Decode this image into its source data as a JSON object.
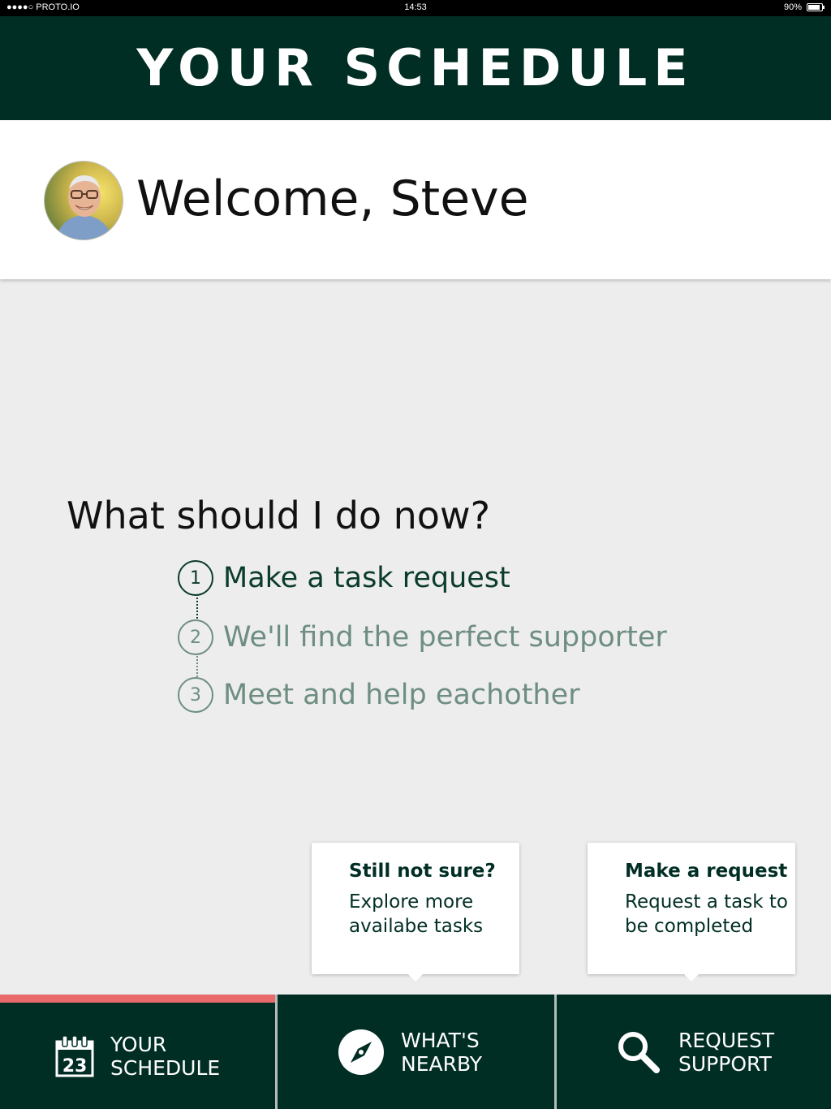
{
  "status_bar": {
    "carrier": "●●●●○ PROTO.IO",
    "time": "14:53",
    "battery": "90%"
  },
  "header": {
    "title": "YOUR SCHEDULE"
  },
  "welcome": {
    "greeting": "Welcome, Steve"
  },
  "guide": {
    "question": "What should I do now?",
    "steps": [
      {
        "number": "1",
        "label": "Make a task request"
      },
      {
        "number": "2",
        "label": "We'll find the perfect supporter"
      },
      {
        "number": "3",
        "label": "Meet and help eachother"
      }
    ]
  },
  "tips": [
    {
      "title": "Still not sure?",
      "body": "Explore more availabe tasks"
    },
    {
      "title": "Make a request",
      "body": "Request a task to be completed"
    }
  ],
  "tabs": [
    {
      "label": "YOUR\nSCHEDULE",
      "icon": "calendar-icon",
      "calendar_day": "23",
      "active": true
    },
    {
      "label": "WHAT'S\nNEARBY",
      "icon": "compass-icon",
      "active": false
    },
    {
      "label": "REQUEST\nSUPPORT",
      "icon": "search-icon",
      "active": false
    }
  ],
  "colors": {
    "brand_dark": "#012e24",
    "active_tab_accent": "#e86a6a",
    "step_muted": "#6e8e81"
  }
}
